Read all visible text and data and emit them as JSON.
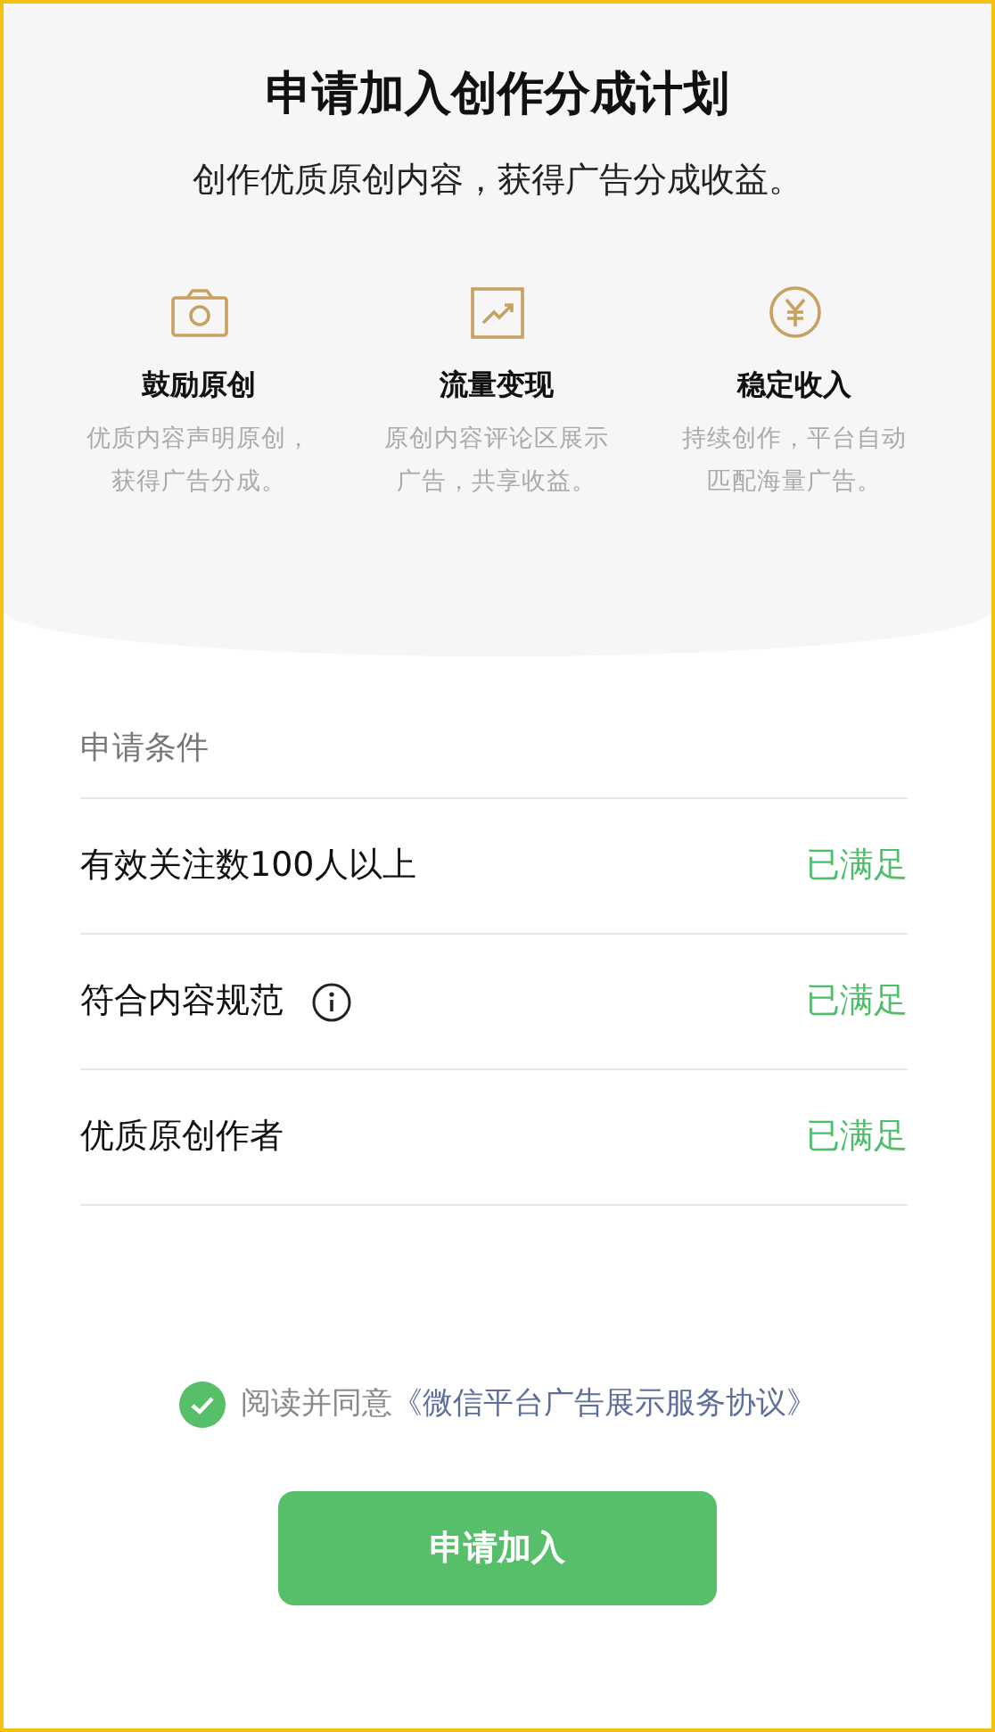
{
  "header": {
    "title": "申请加入创作分成计划",
    "subtitle": "创作优质原创内容，获得广告分成收益。"
  },
  "features": [
    {
      "kind": "camera",
      "title": "鼓励原创",
      "desc": "优质内容声明原创，获得广告分成。"
    },
    {
      "kind": "trend",
      "title": "流量变现",
      "desc": "原创内容评论区展示广告，共享收益。"
    },
    {
      "kind": "yen",
      "title": "稳定收入",
      "desc": "持续创作，平台自动匹配海量广告。"
    }
  ],
  "conditions": {
    "heading": "申请条件",
    "rows": [
      {
        "label": "有效关注数100人以上",
        "info": false,
        "status": "已满足",
        "met": true
      },
      {
        "label": "符合内容规范",
        "info": true,
        "status": "已满足",
        "met": true
      },
      {
        "label": "优质原创作者",
        "info": false,
        "status": "已满足",
        "met": true
      }
    ]
  },
  "agreement": {
    "checked": true,
    "text": "阅读并同意",
    "link": "《微信平台广告展示服务协议》"
  },
  "button": "申请加入"
}
